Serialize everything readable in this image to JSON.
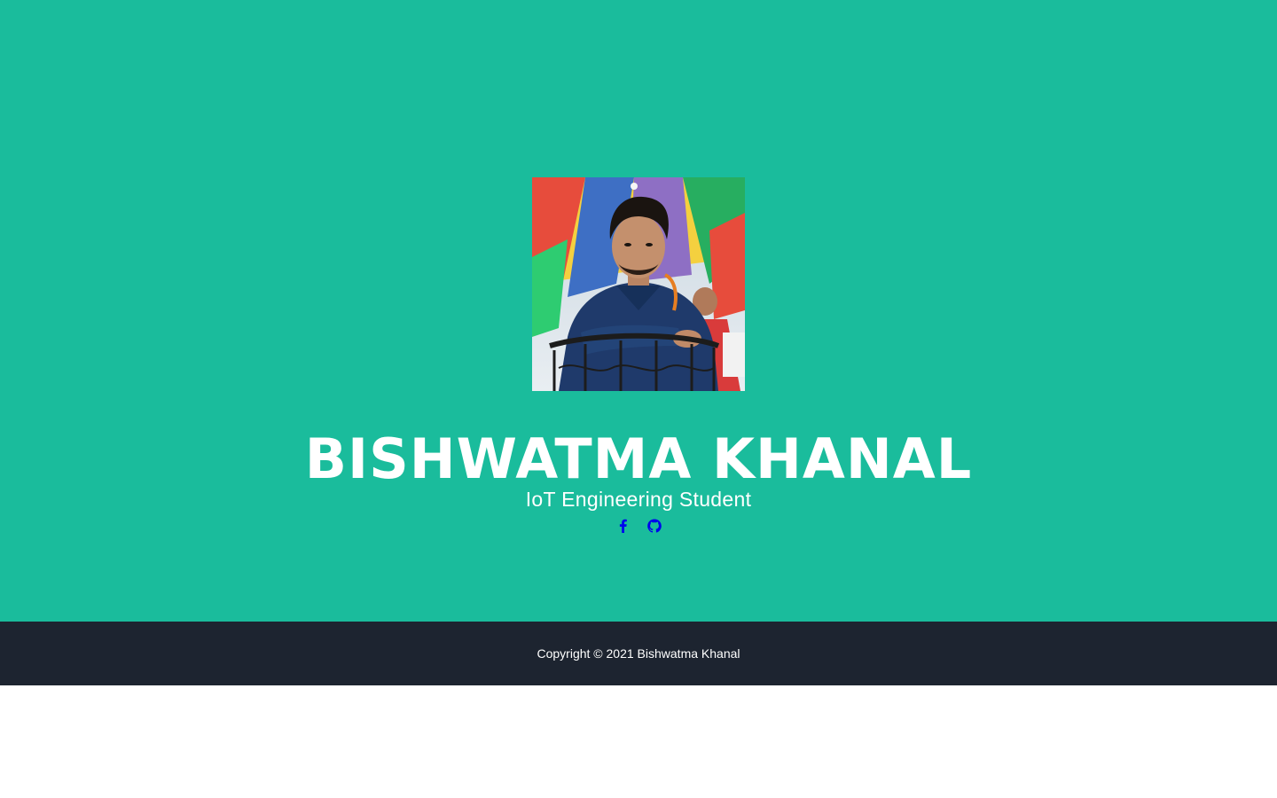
{
  "profile": {
    "name": "BISHWATMA KHANAL",
    "subtitle": "IoT Engineering Student",
    "photo_alt": "profile-photo"
  },
  "social": [
    {
      "icon": "facebook-icon",
      "label": "Facebook"
    },
    {
      "icon": "github-icon",
      "label": "GitHub"
    }
  ],
  "footer": {
    "copyright": "Copyright © 2021 Bishwatma Khanal"
  },
  "colors": {
    "hero_bg": "#1abc9c",
    "footer_bg": "#1d2430",
    "text": "#ffffff",
    "icon": "#0000ee"
  }
}
